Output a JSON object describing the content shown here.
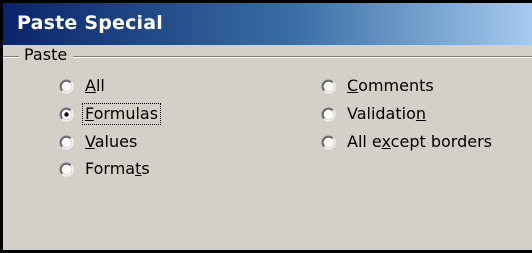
{
  "dialog": {
    "title": "Paste Special",
    "paste_group_label": "Paste",
    "selected_option": "Formulas"
  },
  "options": {
    "all": {
      "pre": "",
      "key": "A",
      "post": "ll",
      "checked": false
    },
    "formulas": {
      "pre": "",
      "key": "F",
      "post": "ormulas",
      "checked": true
    },
    "values": {
      "pre": "",
      "key": "V",
      "post": "alues",
      "checked": false
    },
    "formats": {
      "pre": "Forma",
      "key": "t",
      "post": "s",
      "checked": false
    },
    "comments": {
      "pre": "",
      "key": "C",
      "post": "omments",
      "checked": false
    },
    "validation": {
      "pre": "Validatio",
      "key": "n",
      "post": "",
      "checked": false
    },
    "all_except_borders": {
      "pre": "All e",
      "key": "x",
      "post": "cept borders",
      "checked": false
    }
  },
  "colors": {
    "title_bar_start": "#0a246a",
    "title_bar_end": "#a6caf0",
    "dialog_face": "#d4d0c8"
  }
}
